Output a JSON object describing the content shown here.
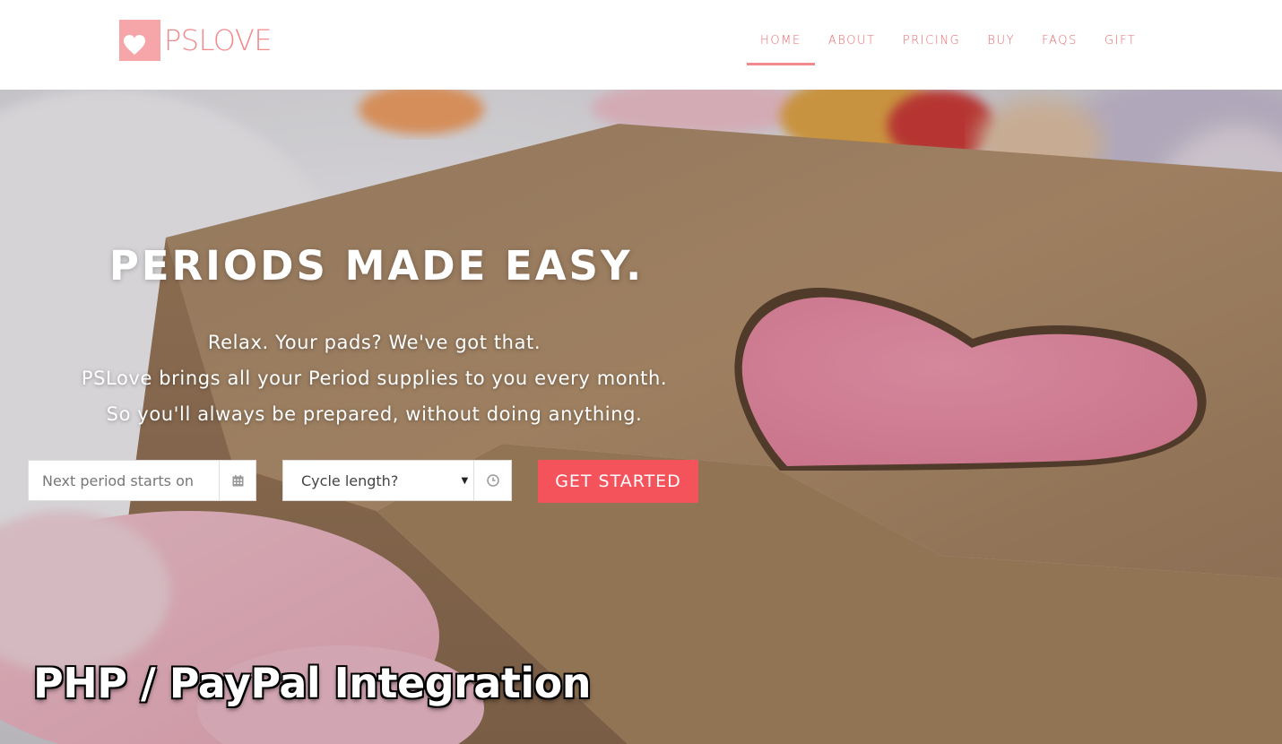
{
  "brand": {
    "name": "PSLOVE",
    "logo_color": "#f6a5a8",
    "text_color": "#f28b8e"
  },
  "nav": {
    "items": [
      {
        "label": "HOME",
        "active": true
      },
      {
        "label": "ABOUT",
        "active": false
      },
      {
        "label": "PRICING",
        "active": false
      },
      {
        "label": "BUY",
        "active": false
      },
      {
        "label": "FAQS",
        "active": false
      },
      {
        "label": "GIFT",
        "active": false
      }
    ],
    "color": "#e9686d"
  },
  "hero": {
    "title": "PERIODS MADE EASY.",
    "lines": [
      "Relax. Your pads? We've got that.",
      "PSLove brings all your Period supplies to you every month.",
      "So you'll always be prepared, without doing anything."
    ]
  },
  "form": {
    "date_placeholder": "Next period starts on",
    "date_icon": "calendar-icon",
    "cycle_selected": "Cycle length?",
    "cycle_icon": "clock-icon",
    "cta_label": "GET STARTED",
    "cta_color": "#f5535c"
  },
  "overlay_caption": "PHP / PayPal Integration"
}
